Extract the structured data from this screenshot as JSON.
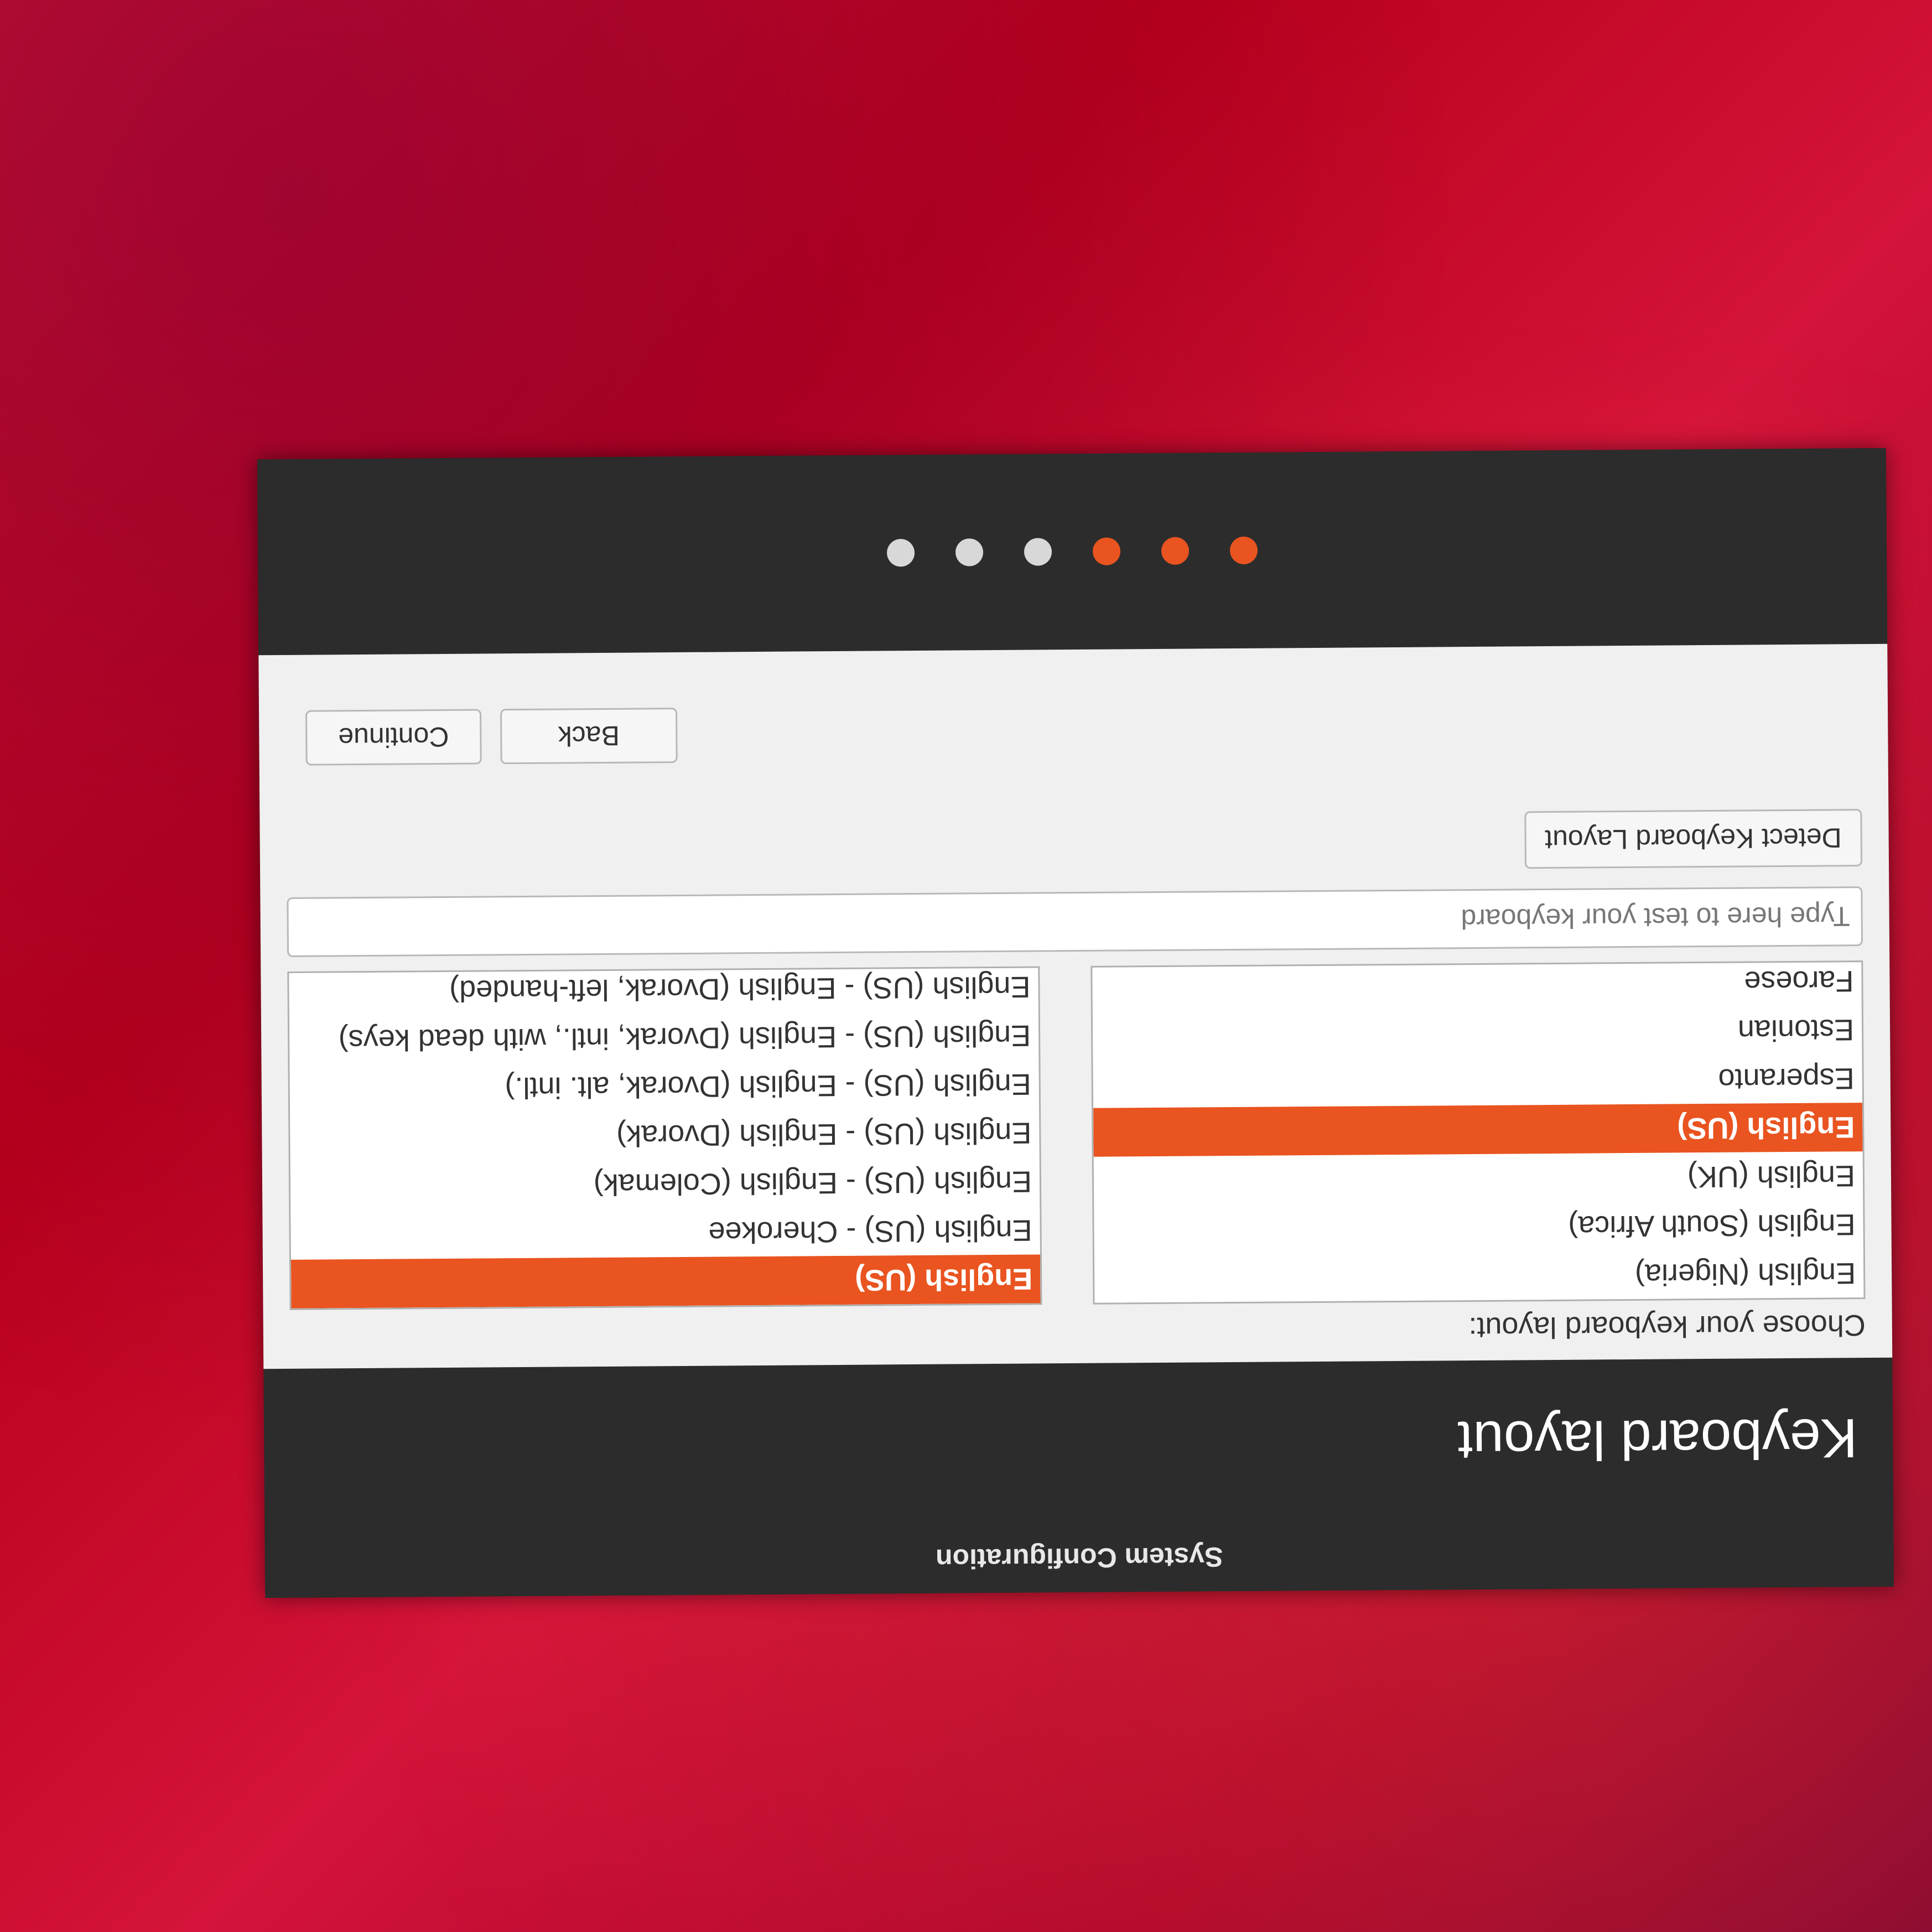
{
  "window": {
    "title": "System Configuration"
  },
  "header": {
    "page_title": "Keyboard layout"
  },
  "main": {
    "prompt": "Choose your keyboard layout:",
    "languages": [
      "English (Nigeria)",
      "English (South Africa)",
      "English (UK)",
      "English (US)",
      "Esperanto",
      "Estonian",
      "Faroese"
    ],
    "selected_language": "English (US)",
    "variants": [
      "English (US)",
      "English (US) - Cherokee",
      "English (US) - English (Colemak)",
      "English (US) - English (Dvorak)",
      "English (US) - English (Dvorak, alt. intl.)",
      "English (US) - English (Dvorak, intl., with dead keys)",
      "English (US) - English (Dvorak, left-handed)"
    ],
    "selected_variant": "English (US)",
    "test_input": {
      "value": "",
      "placeholder": "Type here to test your keyboard"
    },
    "detect_button_label": "Detect Keyboard Layout"
  },
  "navigation": {
    "back_label": "Back",
    "continue_label": "Continue"
  },
  "progress": {
    "total_steps": 6,
    "completed_steps": 3
  },
  "colors": {
    "accent": "#e95420",
    "window_dark": "#2c2c2c",
    "content_bg": "#f0f0f0"
  }
}
